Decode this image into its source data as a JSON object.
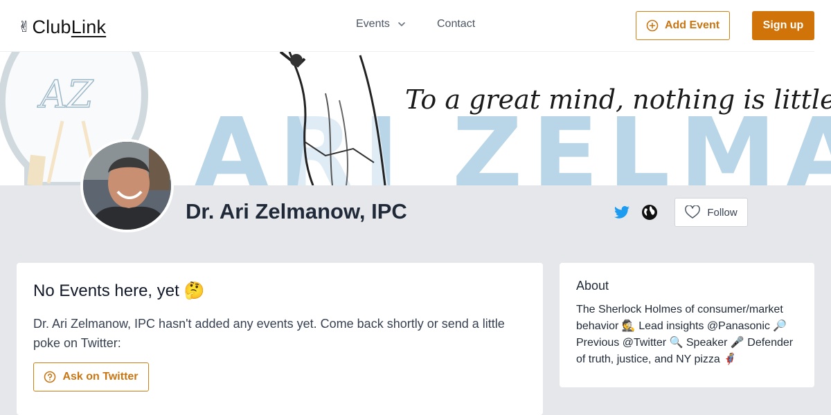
{
  "header": {
    "logo_hand": "✌",
    "logo_prefix": "Club",
    "logo_link": "Link",
    "nav": {
      "events_label": "Events",
      "contact_label": "Contact"
    },
    "add_event_label": "Add Event",
    "signup_label": "Sign up"
  },
  "banner": {
    "quote": "To a great mind, nothing is little...",
    "brand_text": "ARI ZELMANOW",
    "monogram": "AZ"
  },
  "profile": {
    "name": "Dr. Ari Zelmanow, IPC",
    "follow_label": "Follow",
    "icons": [
      "twitter-icon",
      "globe-icon"
    ]
  },
  "events": {
    "empty_title": "No Events here, yet 🤔",
    "empty_desc": "Dr. Ari Zelmanow, IPC hasn't added any events yet. Come back shortly or send a little poke on Twitter:",
    "ask_label": "Ask on Twitter"
  },
  "about": {
    "title": "About",
    "text": "The Sherlock Holmes of consumer/market behavior 🕵️ Lead insights @Panasonic 🔎 Previous @Twitter 🔍 Speaker 🎤 Defender of truth, justice, and NY pizza 🦸"
  },
  "colors": {
    "accent": "#d07409",
    "accent_text": "#c87512",
    "page_bg": "#e5e7eb",
    "twitter": "#1d9bf0"
  }
}
